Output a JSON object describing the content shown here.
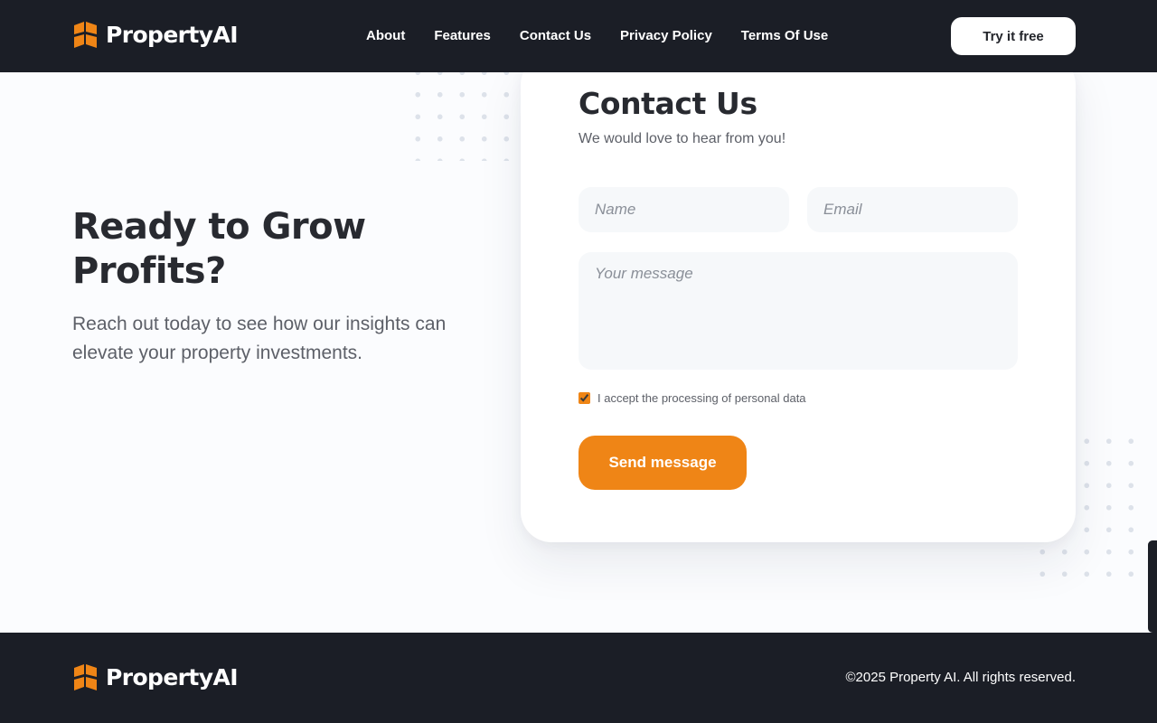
{
  "brand": {
    "name": "PropertyAI",
    "accent_color": "#ef8516",
    "dark_color": "#1b1e26"
  },
  "header": {
    "nav": [
      {
        "label": "About"
      },
      {
        "label": "Features"
      },
      {
        "label": "Contact Us"
      },
      {
        "label": "Privacy Policy"
      },
      {
        "label": "Terms Of Use"
      }
    ],
    "cta_label": "Try it free"
  },
  "hero": {
    "title": "Ready to Grow Profits?",
    "subtitle": "Reach out today to see how our insights can elevate your property investments."
  },
  "contact": {
    "title": "Contact Us",
    "subtitle": "We would love to hear from you!",
    "name_placeholder": "Name",
    "email_placeholder": "Email",
    "message_placeholder": "Your message",
    "consent_label": "I accept the processing of personal data",
    "consent_checked": true,
    "submit_label": "Send message"
  },
  "footer": {
    "copyright": "©2025 Property AI. All rights reserved."
  },
  "icons": {
    "logo": "building-blocks-icon"
  }
}
